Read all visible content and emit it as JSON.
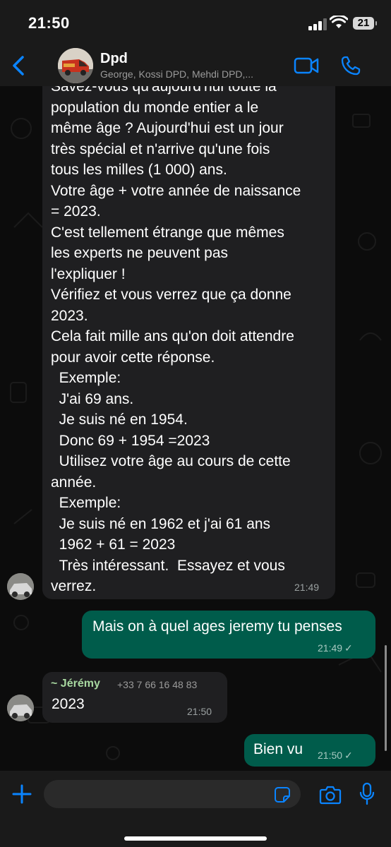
{
  "status_bar": {
    "time": "21:50",
    "battery": "21"
  },
  "header": {
    "title": "Dpd",
    "subtitle": "George, Kossi DPD, Mehdi DPD,..."
  },
  "messages": [
    {
      "type": "incoming",
      "text": "Savez-vous qu'aujourd'hui toute la\npopulation du monde entier a le\nmême âge ? Aujourd'hui est un jour\ntrès spécial et n'arrive qu'une fois\ntous les milles (1 000) ans.\nVotre âge + votre année de naissance\n= 2023.\nC'est tellement étrange que mêmes\nles experts ne peuvent pas\nl'expliquer !\nVérifiez et vous verrez que ça donne\n2023.\nCela fait mille ans qu'on doit attendre\npour avoir cette réponse.\n  Exemple:\n  J'ai 69 ans.\n  Je suis né en 1954.\n  Donc 69 + 1954 =2023\n  Utilisez votre âge au cours de cette\nannée.\n  Exemple:\n  Je suis né en 1962 et j'ai 61 ans\n  1962 + 61 = 2023\n  Très intéressant.  Essayez et vous\nverrez.",
      "time": "21:49"
    },
    {
      "type": "outgoing",
      "text": "Mais on à quel ages jeremy tu penses",
      "time": "21:49",
      "tick": "✓"
    },
    {
      "type": "incoming",
      "sender": "~ Jérémy",
      "phone": "+33 7 66 16 48 83",
      "text": "2023",
      "time": "21:50"
    },
    {
      "type": "outgoing",
      "text": "Bien vu",
      "time": "21:50",
      "tick": "✓"
    }
  ],
  "icons": {
    "back": "chevron-left-icon",
    "video": "video-camera-icon",
    "call": "phone-icon",
    "plus": "plus-icon",
    "sticker": "sticker-icon",
    "camera": "camera-icon",
    "mic": "microphone-icon"
  },
  "colors": {
    "accent": "#0a84ff",
    "outgoing_bubble": "#005c4b",
    "incoming_bubble": "#1f1f21",
    "sender_name": "#a8d8a0"
  }
}
